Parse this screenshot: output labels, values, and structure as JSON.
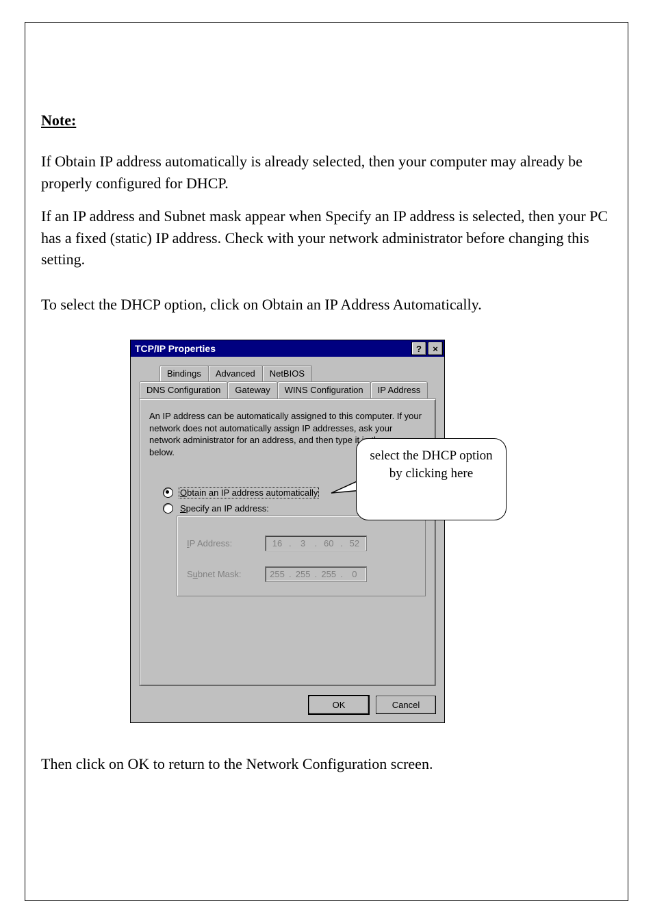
{
  "note": {
    "label": "Note:",
    "para1": "If Obtain IP address automatically is already selected, then your computer may already be properly configured for DHCP.",
    "para2": "If an IP address and Subnet mask appear when Specify an IP address is selected, then your PC has a fixed (static) IP address. Check with your network administrator before changing this setting.",
    "intro": "To select the DHCP option, click on Obtain an IP Address Automatically."
  },
  "dialog": {
    "title": "TCP/IP Properties",
    "controls": {
      "help": "?",
      "close": "×"
    },
    "tabs_back": [
      "Bindings",
      "Advanced",
      "NetBIOS"
    ],
    "tabs_front": [
      "DNS Configuration",
      "Gateway",
      "WINS Configuration",
      "IP Address"
    ],
    "selected_tab": "IP Address",
    "description": "An IP address can be automatically assigned to this computer. If your network does not automatically assign IP addresses, ask your network administrator for an address, and then type it in the space below.",
    "radios": {
      "auto": "Obtain an IP address automatically",
      "auto_u": "O",
      "specify": "Specify an IP address:",
      "specify_u": "S"
    },
    "fields": {
      "ip_label": "IP Address:",
      "ip_u": "I",
      "ip_value": [
        "16",
        "3",
        "60",
        "52"
      ],
      "mask_label": "Subnet Mask:",
      "mask_u": "u",
      "mask_value": [
        "255",
        "255",
        "255",
        "0"
      ]
    },
    "buttons": {
      "ok": "OK",
      "cancel": "Cancel"
    }
  },
  "callout": {
    "text": "select the DHCP option by clicking here"
  },
  "final": "Then click on OK to return to the Network Configuration screen."
}
